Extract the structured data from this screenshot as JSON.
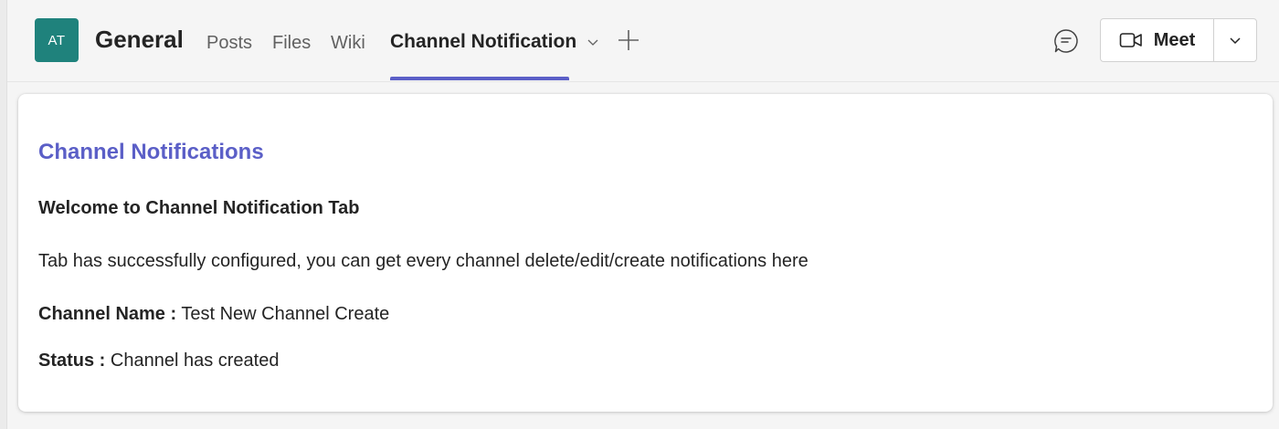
{
  "header": {
    "avatar_initials": "AT",
    "channel_title": "General",
    "tabs": [
      {
        "label": "Posts"
      },
      {
        "label": "Files"
      },
      {
        "label": "Wiki"
      }
    ],
    "active_tab": {
      "label": "Channel Notification"
    },
    "meet_label": "Meet",
    "icons": {
      "add_tab": "plus-icon",
      "chat": "chat-bubble-icon",
      "meet": "video-camera-icon",
      "dropdown": "chevron-down-icon"
    }
  },
  "content": {
    "heading": "Channel Notifications",
    "welcome": "Welcome to Channel Notification Tab",
    "description": "Tab has successfully configured, you can get every channel delete/edit/create notifications here",
    "channel_name_label": "Channel Name :",
    "channel_name_value": "Test New Channel Create",
    "status_label": "Status :",
    "status_value": "Channel has created"
  },
  "colors": {
    "accent": "#5b5fc7",
    "avatar_bg": "#1f827c",
    "background": "#f5f5f5"
  }
}
